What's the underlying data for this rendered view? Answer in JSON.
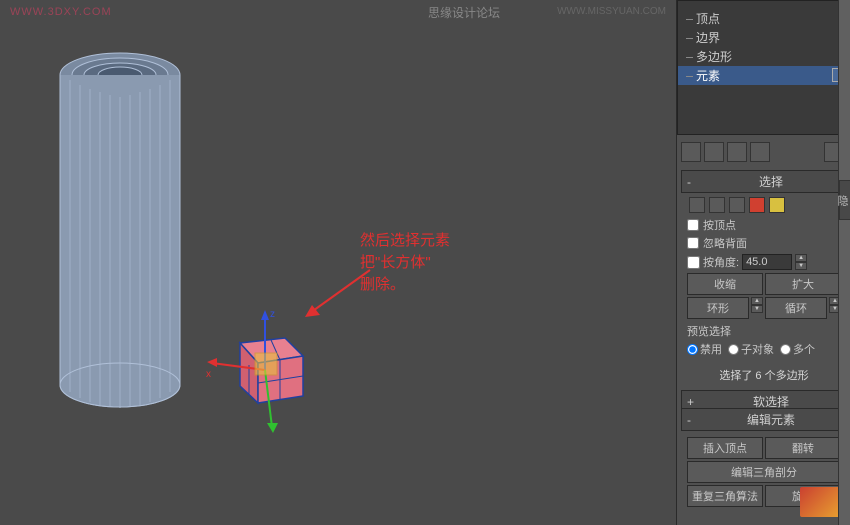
{
  "watermarks": {
    "left": "WWW.3DXY.COM",
    "top": "思缘设计论坛",
    "top_url": "WWW.MISSYUAN.COM"
  },
  "annotation": {
    "line1": "然后选择元素",
    "line2": "把\"长方体\"",
    "line3": "删除。"
  },
  "tree": {
    "items": [
      "顶点",
      "边界",
      "多边形",
      "元素"
    ],
    "selected_index": 3
  },
  "sections": {
    "select": {
      "title": "选择",
      "by_vertex": "按顶点",
      "ignore_backface": "忽略背面",
      "by_angle": "按角度:",
      "angle_value": "45.0",
      "shrink": "收缩",
      "grow": "扩大",
      "ring": "环形",
      "loop": "循环",
      "preview_label": "预览选择",
      "radio_off": "禁用",
      "radio_sub": "子对象",
      "radio_multi": "多个",
      "status": "选择了 6 个多边形"
    },
    "soft": {
      "title": "软选择",
      "collapsed": true
    },
    "edit": {
      "title": "编辑元素",
      "insert_vertex": "插入顶点",
      "flip": "翻转",
      "edit_tri": "编辑三角剖分",
      "retri": "重复三角算法",
      "rotate": "旋转"
    }
  },
  "right_edge": "隐"
}
